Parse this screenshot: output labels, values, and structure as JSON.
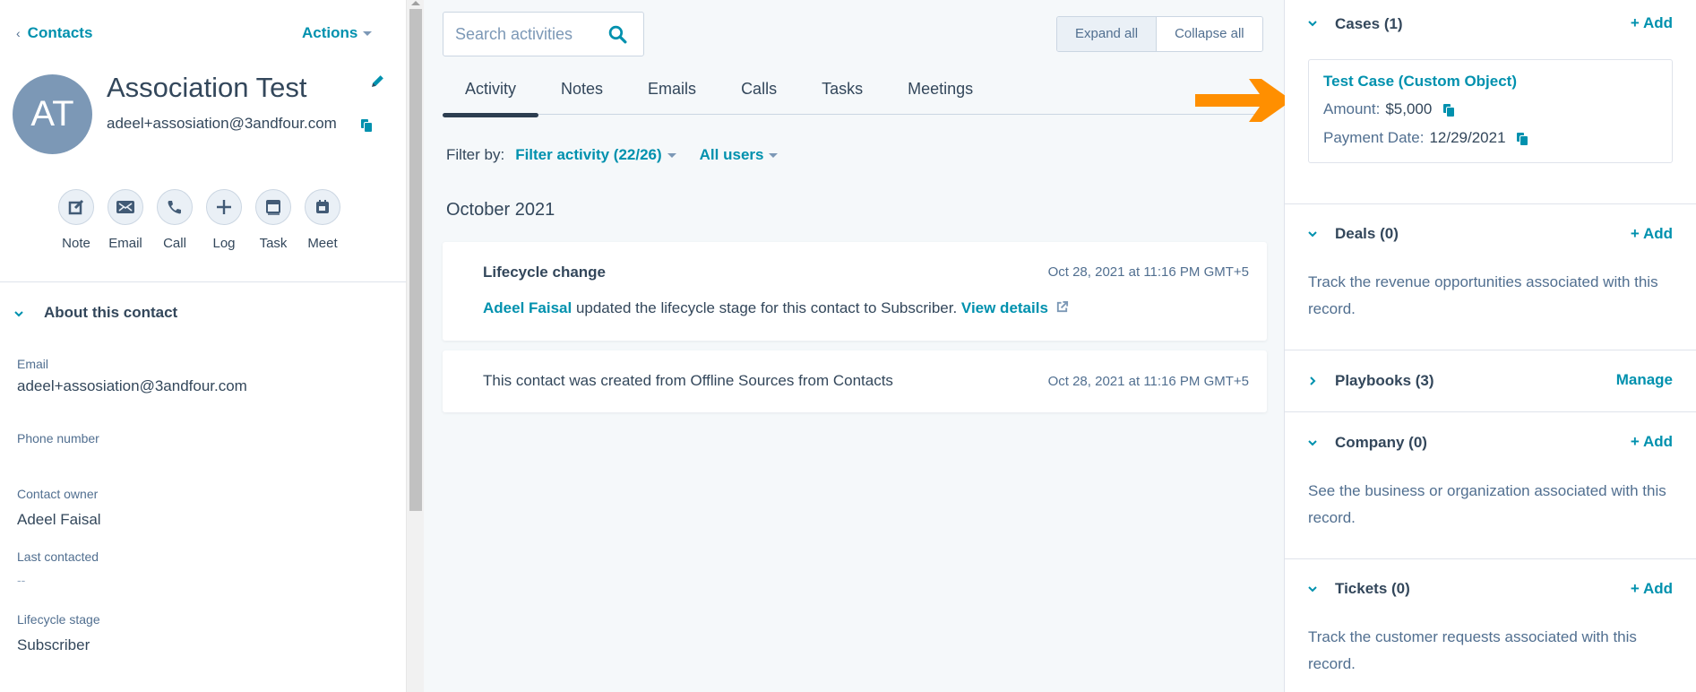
{
  "header": {
    "back_label": "Contacts",
    "actions_label": "Actions"
  },
  "contact": {
    "initials": "AT",
    "name": "Association Test",
    "email": "adeel+assosiation@3andfour.com",
    "avatar_color": "#7c98b6"
  },
  "quick_actions": [
    {
      "label": "Note",
      "icon": "note-edit-icon"
    },
    {
      "label": "Email",
      "icon": "envelope-icon"
    },
    {
      "label": "Call",
      "icon": "phone-icon"
    },
    {
      "label": "Log",
      "icon": "plus-icon"
    },
    {
      "label": "Task",
      "icon": "task-icon"
    },
    {
      "label": "Meet",
      "icon": "calendar-icon"
    }
  ],
  "about": {
    "title": "About this contact",
    "properties": [
      {
        "label": "Email",
        "value": "adeel+assosiation@3andfour.com"
      },
      {
        "label": "Phone number",
        "value": ""
      },
      {
        "label": "Contact owner",
        "value": "Adeel Faisal"
      },
      {
        "label": "Last contacted",
        "value": "--"
      },
      {
        "label": "Lifecycle stage",
        "value": "Subscriber"
      }
    ]
  },
  "timeline": {
    "search_placeholder": "Search activities",
    "expand_all": "Expand all",
    "collapse_all": "Collapse all",
    "tabs": [
      {
        "label": "Activity",
        "active": true
      },
      {
        "label": "Notes"
      },
      {
        "label": "Emails"
      },
      {
        "label": "Calls"
      },
      {
        "label": "Tasks"
      },
      {
        "label": "Meetings"
      }
    ],
    "filter_label": "Filter by:",
    "filter_activity": "Filter activity (22/26)",
    "filter_users": "All users",
    "month": "October 2021",
    "items": [
      {
        "title": "Lifecycle change",
        "actor": "Adeel Faisal",
        "text": " updated the lifecycle stage for this contact to Subscriber. ",
        "link": "View details",
        "timestamp": "Oct 28, 2021 at 11:16 PM GMT+5"
      },
      {
        "text": "This contact was created from Offline Sources from Contacts",
        "timestamp": "Oct 28, 2021 at 11:16 PM GMT+5"
      }
    ]
  },
  "annotation": {
    "arrow_color": "#ff8f00"
  },
  "sidebar": {
    "cases": {
      "title": "Cases (1)",
      "action": "+ Add",
      "record": {
        "name": "Test Case (Custom Object)",
        "amount_label": "Amount:",
        "amount_value": "$5,000",
        "date_label": "Payment Date:",
        "date_value": "12/29/2021"
      }
    },
    "deals": {
      "title": "Deals (0)",
      "action": "+ Add",
      "desc": "Track the revenue opportunities associated with this record."
    },
    "playbooks": {
      "title": "Playbooks (3)",
      "action": "Manage"
    },
    "company": {
      "title": "Company (0)",
      "action": "+ Add",
      "desc": "See the business or organization associated with this record."
    },
    "tickets": {
      "title": "Tickets (0)",
      "action": "+ Add",
      "desc": "Track the customer requests associated with this record."
    }
  }
}
